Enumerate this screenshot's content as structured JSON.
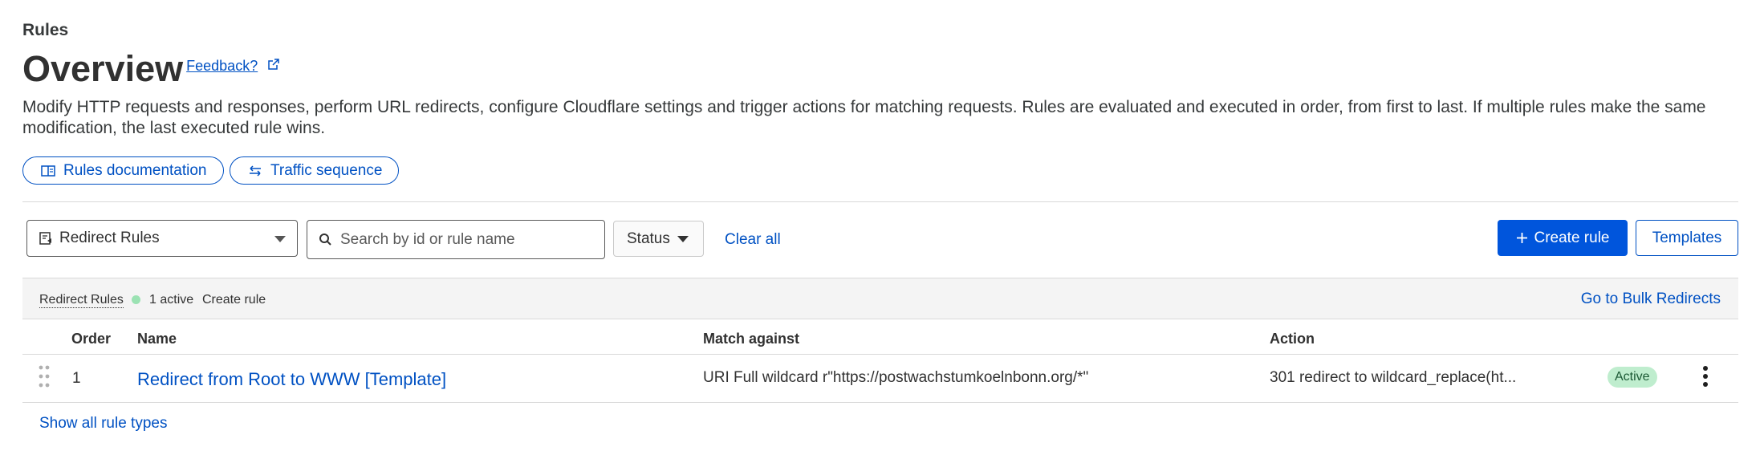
{
  "breadcrumb": "Rules",
  "page_title": "Overview",
  "feedback_link": "Feedback?",
  "description": "Modify HTTP requests and responses, perform URL redirects, configure Cloudflare settings and trigger actions for matching requests. Rules are evaluated and executed in order, from first to last. If multiple rules make the same modification, the last executed rule wins.",
  "links": {
    "docs": "Rules documentation",
    "traffic": "Traffic sequence"
  },
  "filters": {
    "rule_type_selected": "Redirect Rules",
    "search_placeholder": "Search by id or rule name",
    "status_label": "Status",
    "clear_all": "Clear all"
  },
  "actions": {
    "create_rule": "Create rule",
    "templates": "Templates"
  },
  "group": {
    "name": "Redirect Rules",
    "active_count": "1 active",
    "create_rule": "Create rule",
    "bulk_link": "Go to Bulk Redirects"
  },
  "table": {
    "headers": {
      "order": "Order",
      "name": "Name",
      "match": "Match against",
      "action": "Action"
    },
    "rows": [
      {
        "order": "1",
        "name": "Redirect from Root to WWW [Template]",
        "match": "URI Full wildcard r\"https://postwachstumkoelnbonn.org/*\"",
        "action": "301 redirect to wildcard_replace(ht...",
        "status": "Active"
      }
    ]
  },
  "show_all": "Show all rule types",
  "colors": {
    "link_blue": "#0051c3",
    "primary_button": "#0055dc",
    "active_badge_bg": "#bfedce",
    "active_dot": "#9be2b3"
  }
}
